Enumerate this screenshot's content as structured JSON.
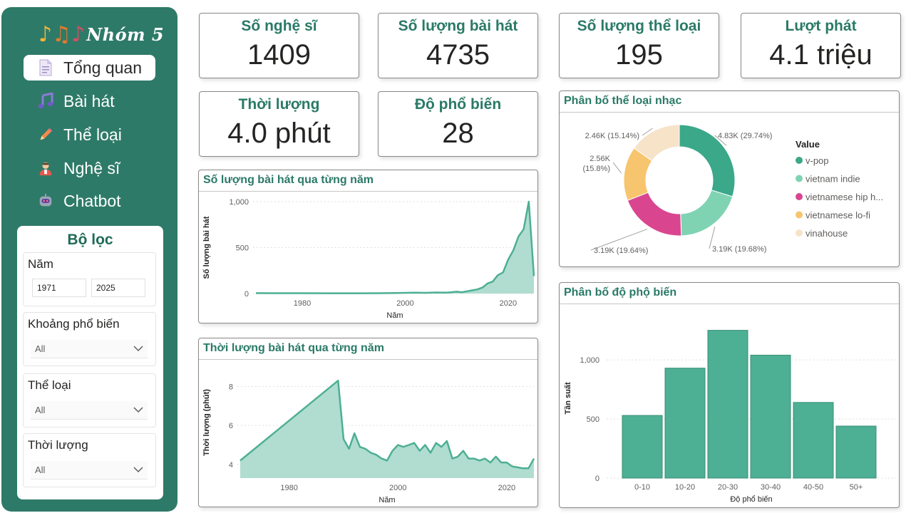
{
  "sidebar": {
    "logo_text": "Nhóm 5",
    "nav": [
      {
        "label": "Tổng quan",
        "icon": "document-icon",
        "active": true
      },
      {
        "label": "Bài hát",
        "icon": "music-note-icon",
        "active": false
      },
      {
        "label": "Thể loại",
        "icon": "pencil-icon",
        "active": false
      },
      {
        "label": "Nghệ sĩ",
        "icon": "singer-icon",
        "active": false
      },
      {
        "label": "Chatbot",
        "icon": "robot-icon",
        "active": false
      }
    ]
  },
  "filters": {
    "title": "Bộ lọc",
    "year": {
      "label": "Năm",
      "from": "1971",
      "to": "2025"
    },
    "popularity": {
      "label": "Khoảng phổ biến",
      "value": "All"
    },
    "genre": {
      "label": "Thể loại",
      "value": "All"
    },
    "duration": {
      "label": "Thời lượng",
      "value": "All"
    }
  },
  "kpis": [
    {
      "label": "Số nghệ sĩ",
      "value": "1409"
    },
    {
      "label": "Số lượng bài hát",
      "value": "4735"
    },
    {
      "label": "Số lượng thể loại",
      "value": "195"
    },
    {
      "label": "Lượt phát",
      "value": "4.1 triệu"
    },
    {
      "label": "Thời lượng",
      "value": "4.0 phút"
    },
    {
      "label": "Độ phổ biến",
      "value": "28"
    }
  ],
  "colors": {
    "accent": "#2e7a68",
    "series": "#4daf93",
    "area": "#b0ddd0"
  },
  "chart_data": [
    {
      "id": "songs-per-year",
      "type": "area",
      "title": "Số lượng bài hát qua từng năm",
      "xlabel": "Năm",
      "ylabel": "Số lượng bài hát",
      "xlim": [
        1971,
        2025
      ],
      "ylim": [
        0,
        1000
      ],
      "yticks": [
        0,
        500,
        1000
      ],
      "ytick_labels": [
        "0",
        "500",
        "1,000"
      ],
      "xticks": [
        1980,
        2000,
        2020
      ],
      "x": [
        1971,
        1975,
        1980,
        1985,
        1990,
        1995,
        1998,
        2000,
        2002,
        2004,
        2006,
        2008,
        2010,
        2011,
        2012,
        2013,
        2014,
        2015,
        2016,
        2017,
        2018,
        2019,
        2020,
        2021,
        2022,
        2023,
        2024,
        2025
      ],
      "y": [
        5,
        4,
        4,
        3,
        3,
        4,
        6,
        8,
        10,
        8,
        12,
        10,
        20,
        15,
        25,
        35,
        45,
        65,
        110,
        130,
        200,
        230,
        370,
        470,
        620,
        700,
        1000,
        190
      ]
    },
    {
      "id": "duration-per-year",
      "type": "area",
      "title": "Thời lượng bài hát qua từng năm",
      "xlabel": "Năm",
      "ylabel": "Thời lượng (phút)",
      "xlim": [
        1971,
        2025
      ],
      "ylim": [
        3.3,
        9
      ],
      "yticks": [
        4,
        6,
        8
      ],
      "ytick_labels": [
        "4",
        "6",
        "8"
      ],
      "xticks": [
        1980,
        2000,
        2020
      ],
      "x": [
        1971,
        1989,
        1990,
        1991,
        1992,
        1993,
        1994,
        1995,
        1996,
        1997,
        1998,
        1999,
        2000,
        2001,
        2002,
        2003,
        2004,
        2005,
        2006,
        2007,
        2008,
        2009,
        2010,
        2011,
        2012,
        2013,
        2014,
        2015,
        2016,
        2017,
        2018,
        2019,
        2020,
        2021,
        2022,
        2023,
        2024,
        2025
      ],
      "y": [
        4.2,
        8.3,
        5.3,
        4.8,
        5.6,
        4.9,
        4.8,
        4.6,
        4.5,
        4.3,
        4.2,
        4.7,
        5.0,
        4.9,
        5.0,
        5.1,
        4.7,
        5.0,
        4.6,
        5.1,
        4.9,
        5.2,
        4.3,
        4.4,
        4.7,
        4.3,
        4.3,
        4.2,
        4.3,
        4.1,
        4.4,
        4.1,
        4.1,
        3.9,
        3.85,
        3.8,
        3.8,
        4.3
      ]
    },
    {
      "id": "genre-distribution",
      "type": "pie",
      "title": "Phân bố thể loại nhạc",
      "legend_title": "Value",
      "labels": [
        "v-pop",
        "vietnam indie",
        "vietnamese hip h...",
        "vietnamese lo-fi",
        "vinahouse"
      ],
      "values": [
        4830,
        3190,
        3190,
        2560,
        2460
      ],
      "percents": [
        29.74,
        19.68,
        19.64,
        15.8,
        15.14
      ],
      "data_labels": [
        "4.83K (29.74%)",
        "3.19K (19.68%)",
        "3.19K (19.64%)",
        "2.56K (15.8%)",
        "2.46K (15.14%)"
      ],
      "colors": [
        "#3aa889",
        "#7fd3b3",
        "#d9468f",
        "#f7c56e",
        "#f6e3c8"
      ]
    },
    {
      "id": "popularity-distribution",
      "type": "bar",
      "title": "Phân bố độ phộ biến",
      "xlabel": "Độ phổ biến",
      "ylabel": "Tần suất",
      "categories": [
        "0-10",
        "10-20",
        "20-30",
        "30-40",
        "40-50",
        "50+"
      ],
      "values": [
        530,
        930,
        1250,
        1040,
        640,
        440
      ],
      "ylim": [
        0,
        1350
      ],
      "yticks": [
        0,
        500,
        1000
      ],
      "ytick_labels": [
        "0",
        "500",
        "1,000"
      ]
    }
  ]
}
